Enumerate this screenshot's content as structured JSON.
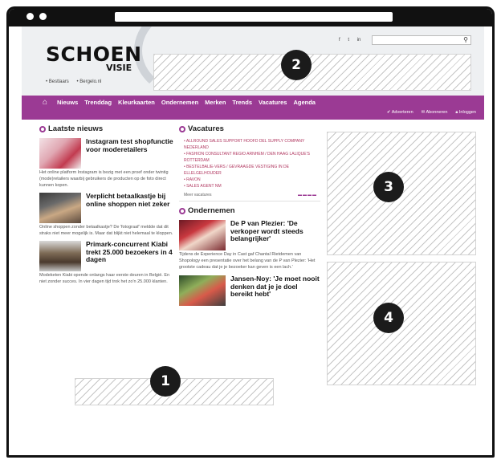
{
  "header": {
    "logo_main": "SCHOEN",
    "logo_sub": "VISIE",
    "links": [
      "Bestlaars",
      "Bergelo.nl"
    ],
    "top_icons": [
      "f",
      "t",
      "in"
    ],
    "search_placeholder": ""
  },
  "nav": {
    "items": [
      "Nieuws",
      "Trenddag",
      "Kleurkaarten",
      "Ondernemen",
      "Merken",
      "Trends",
      "Vacatures",
      "Agenda"
    ],
    "sub": [
      "Adverteren",
      "Abonneren",
      "Inloggen"
    ]
  },
  "left": {
    "title": "Laatste nieuws",
    "news": [
      {
        "headline": "Instagram test shopfunctie voor moderetailers",
        "body": "Het online platform Instagram is bezig met een proef onder twintig (mode)retailers waarbij gebruikers de producten op de foto direct kunnen kopen."
      },
      {
        "headline": "Verplicht betaalkastje bij online shoppen niet zeker",
        "body": "Online shoppen zonder betaalkastje? De 'fotograaf' meldde dat dit straks niet meer mogelijk is. Maar dat blijkt niet helemaal te kloppen."
      },
      {
        "headline": "Primark-concurrent Kiabi trekt 25.000 bezoekers in 4 dagen",
        "body": "Modeketen Kiabi opende onlangs haar eerste deuren in België. En niet zonder succes. In vier dagen tijd trok het zo'n 25.000 klanten."
      }
    ]
  },
  "mid": {
    "vac_title": "Vacatures",
    "vacancies": [
      "Allround sales support hoofd del supply company nederland",
      "Fashion consultant regio Arnhem / Den Haag Lalique's Rotterdam",
      "Bestelbalie-Vers / gevraagde vestiging in de Ellelgelhouder",
      "Ravon",
      "Sales agent nm"
    ],
    "vac_more": "Meer vacatures",
    "ond_title": "Ondernemen",
    "ond_items": [
      {
        "headline": "De P van Plezier: 'De verkoper wordt steeds belangrijker'",
        "body": "Tijdens de Experience Day in Cast gaf Chantal Rietdemen van Shopology een presentatie over het belang van de P van Plezier: 'Het grootste cadeau dat je je bezoeker kan geven is een lach.'"
      },
      {
        "headline": "Jansen-Noy: 'Je moet nooit denken dat je je doel bereikt hebt'",
        "body": ""
      }
    ]
  },
  "markers": [
    "1",
    "2",
    "3",
    "4"
  ]
}
